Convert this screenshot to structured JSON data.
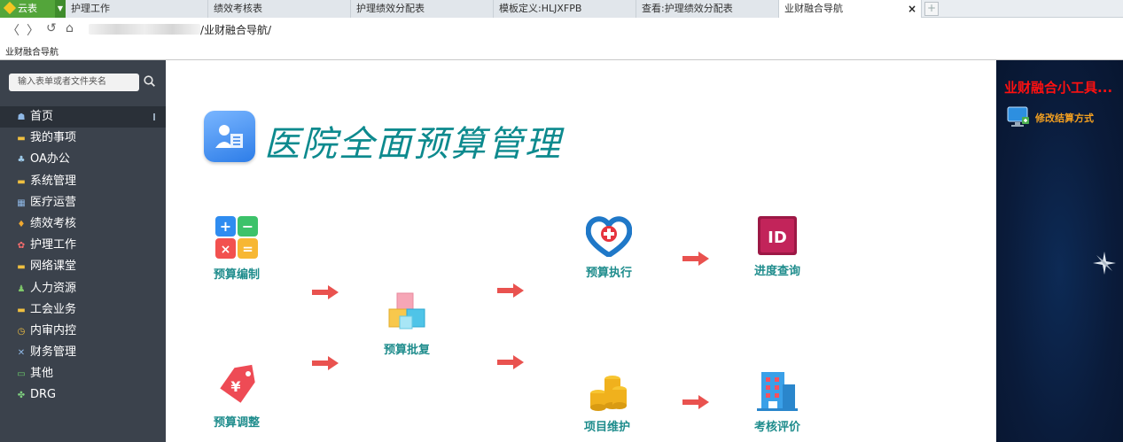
{
  "tabbar": {
    "logo_label": "云表",
    "tabs": [
      {
        "label": "护理工作",
        "active": false
      },
      {
        "label": "绩效考核表",
        "active": false
      },
      {
        "label": "护理绩效分配表",
        "active": false
      },
      {
        "label": "模板定义:HLJXFPB",
        "active": false
      },
      {
        "label": "查看:护理绩效分配表",
        "active": false
      },
      {
        "label": "业财融合导航",
        "active": true
      }
    ],
    "close_glyph": "×",
    "add_glyph": "+"
  },
  "addressbar": {
    "back_glyph": "〈",
    "forward_glyph": "〉",
    "refresh_glyph": "↺",
    "home_glyph": "⌂",
    "path": "/业财融合导航/"
  },
  "breadcrumb": "业财融合导航",
  "sidebar": {
    "search_placeholder": "输入表单或者文件夹名",
    "items": [
      {
        "label": "首页",
        "icon": "home-icon",
        "glyph": "☗",
        "active": true
      },
      {
        "label": "我的事项",
        "icon": "folder-icon",
        "glyph": "▬",
        "active": false
      },
      {
        "label": "OA办公",
        "icon": "org-icon",
        "glyph": "♣",
        "active": false
      },
      {
        "label": "系统管理",
        "icon": "folder-icon",
        "glyph": "▬",
        "active": false
      },
      {
        "label": "医疗运营",
        "icon": "grid-icon",
        "glyph": "▦",
        "active": false
      },
      {
        "label": "绩效考核",
        "icon": "money-bag-icon",
        "glyph": "♦",
        "active": false
      },
      {
        "label": "护理工作",
        "icon": "nurse-icon",
        "glyph": "✿",
        "active": false
      },
      {
        "label": "网络课堂",
        "icon": "folder-icon",
        "glyph": "▬",
        "active": false
      },
      {
        "label": "人力资源",
        "icon": "person-icon",
        "glyph": "♟",
        "active": false
      },
      {
        "label": "工会业务",
        "icon": "folder-icon",
        "glyph": "▬",
        "active": false
      },
      {
        "label": "内审内控",
        "icon": "clock-icon",
        "glyph": "◷",
        "active": false
      },
      {
        "label": "财务管理",
        "icon": "tools-icon",
        "glyph": "✕",
        "active": false
      },
      {
        "label": "其他",
        "icon": "card-icon",
        "glyph": "▭",
        "active": false
      },
      {
        "label": "DRG",
        "icon": "clover-icon",
        "glyph": "✤",
        "active": false
      }
    ]
  },
  "main": {
    "title": "医院全面预算管理",
    "nodes": {
      "budget_compile": "预算编制",
      "budget_adjust": "预算调整",
      "budget_approve": "预算批复",
      "budget_execute": "预算执行",
      "project_maintain": "项目维护",
      "progress_query": "进度查询",
      "assessment": "考核评价"
    }
  },
  "rpanel": {
    "title": "业财融合小工具...",
    "item_label": "修改结算方式"
  },
  "colors": {
    "sidebar_bg": "#3b424c",
    "accent_teal": "#1e8c8c",
    "rpanel_title": "#ff1010",
    "rpanel_item": "#f4a020",
    "tab_logo": "#53a53a"
  }
}
